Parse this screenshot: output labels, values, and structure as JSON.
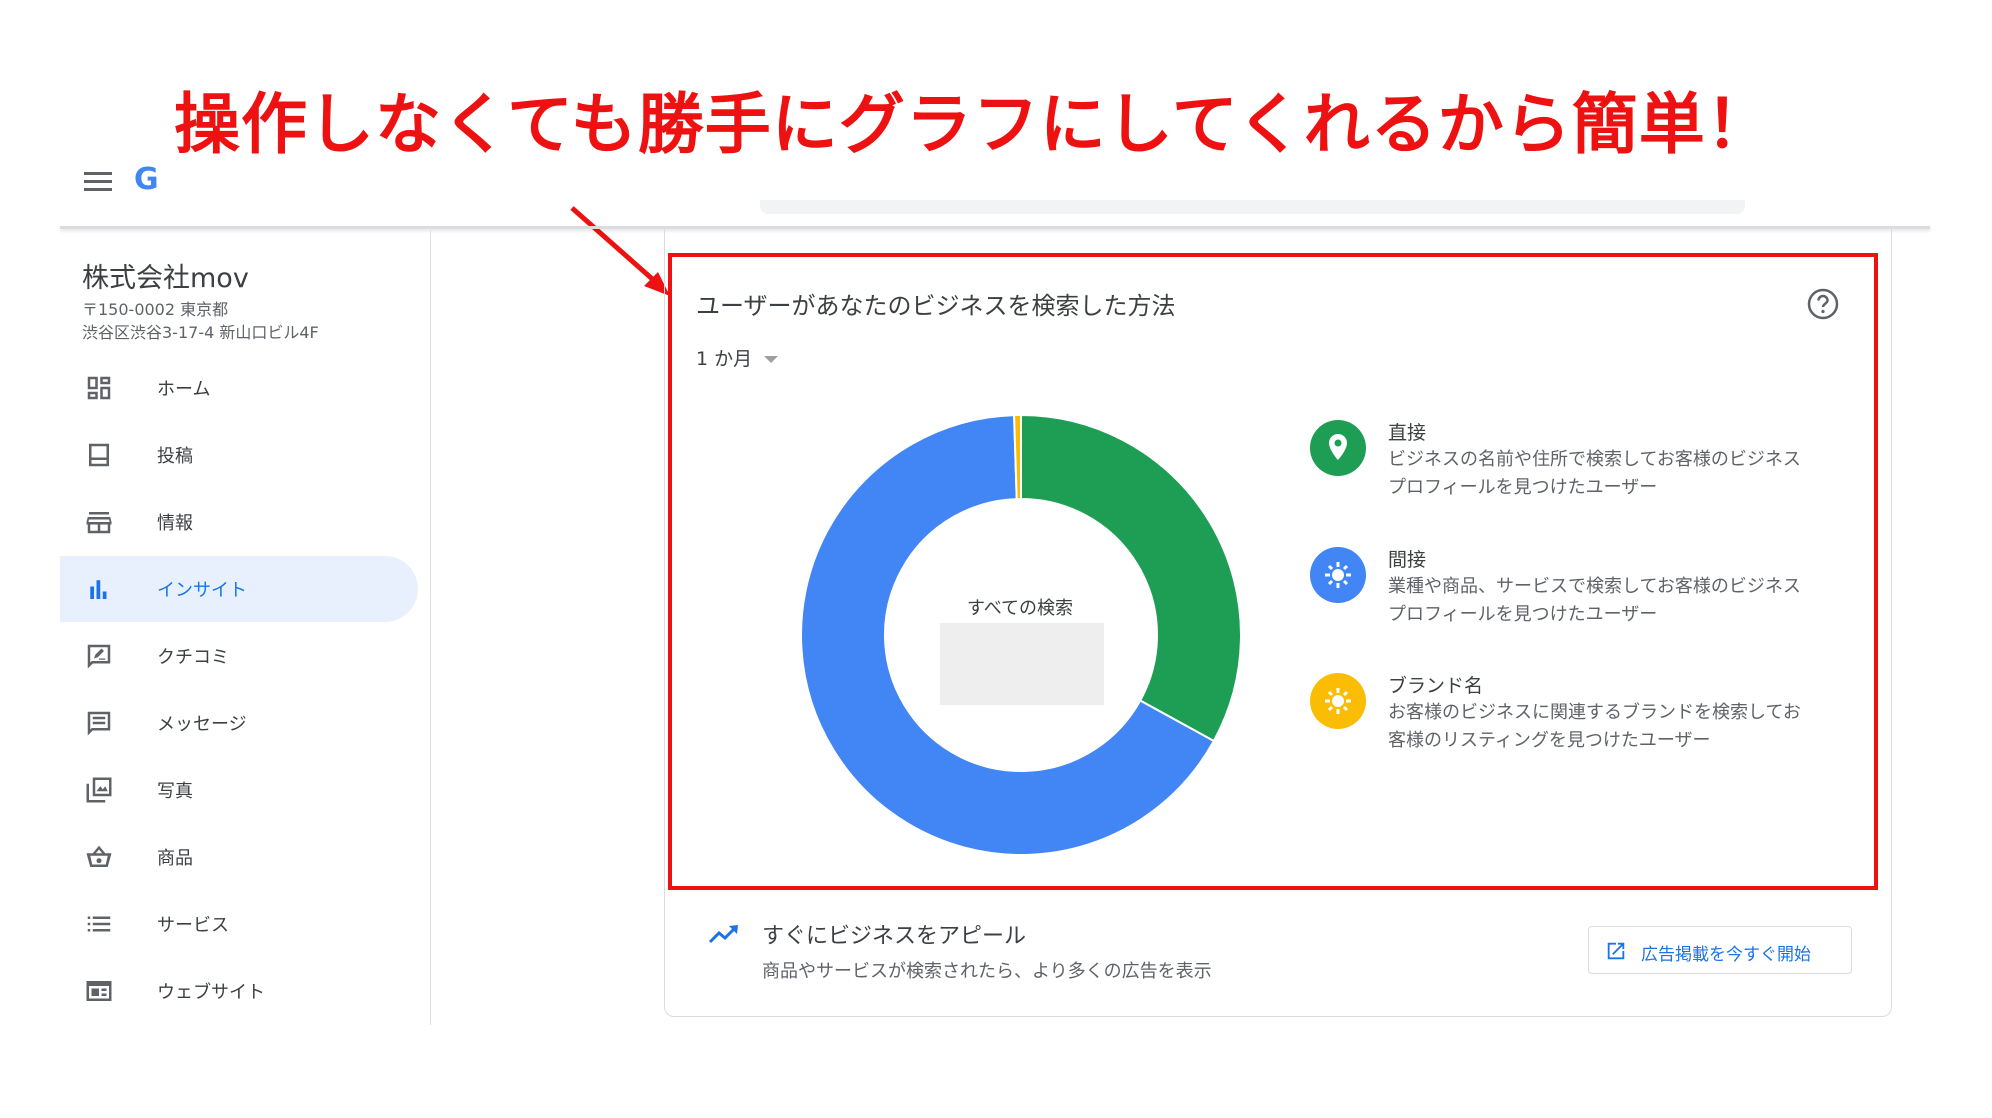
{
  "annotation": {
    "text": "操作しなくても勝手にグラフにしてくれるから簡単！",
    "color": "#ee1111"
  },
  "header": {
    "logo_fragment": "G"
  },
  "business": {
    "name": "株式会社mov",
    "address_line1": "〒150-0002 東京都",
    "address_line2": "渋谷区渋谷3-17-4 新山口ビル4F"
  },
  "sidebar": {
    "items": [
      {
        "label": "ホーム",
        "icon": "dashboard-icon"
      },
      {
        "label": "投稿",
        "icon": "post-icon"
      },
      {
        "label": "情報",
        "icon": "storefront-icon"
      },
      {
        "label": "インサイト",
        "icon": "bar-chart-icon",
        "active": true
      },
      {
        "label": "クチコミ",
        "icon": "review-icon"
      },
      {
        "label": "メッセージ",
        "icon": "message-icon"
      },
      {
        "label": "写真",
        "icon": "photo-icon"
      },
      {
        "label": "商品",
        "icon": "basket-icon"
      },
      {
        "label": "サービス",
        "icon": "list-icon"
      },
      {
        "label": "ウェブサイト",
        "icon": "website-icon"
      }
    ]
  },
  "card": {
    "title": "ユーザーがあなたのビジネスを検索した方法",
    "period": "1 か月",
    "center_label": "すべての検索",
    "legend": [
      {
        "title": "直接",
        "desc": "ビジネスの名前や住所で検索してお客様のビジネス プロフィールを見つけたユーザー",
        "color": "#1e9e54",
        "icon": "location-pin-icon"
      },
      {
        "title": "間接",
        "desc": "業種や商品、サービスで検索してお客様のビジネス プロフィールを見つけたユーザー",
        "color": "#4285f4",
        "icon": "spark-icon"
      },
      {
        "title": "ブランド名",
        "desc": "お客様のビジネスに関連するブランドを検索してお客様のリスティングを見つけたユーザー",
        "color": "#fbbc04",
        "icon": "spark-icon"
      }
    ]
  },
  "chart_data": {
    "type": "pie",
    "categories": [
      "直接",
      "間接",
      "ブランド名"
    ],
    "values": [
      33,
      66.5,
      0.5
    ],
    "colors": [
      "#1e9e54",
      "#4285f4",
      "#fbbc04"
    ]
  },
  "promo": {
    "title": "すぐにビジネスをアピール",
    "desc": "商品やサービスが検索されたら、より多くの広告を表示",
    "button_label": "広告掲載を今すぐ開始"
  }
}
